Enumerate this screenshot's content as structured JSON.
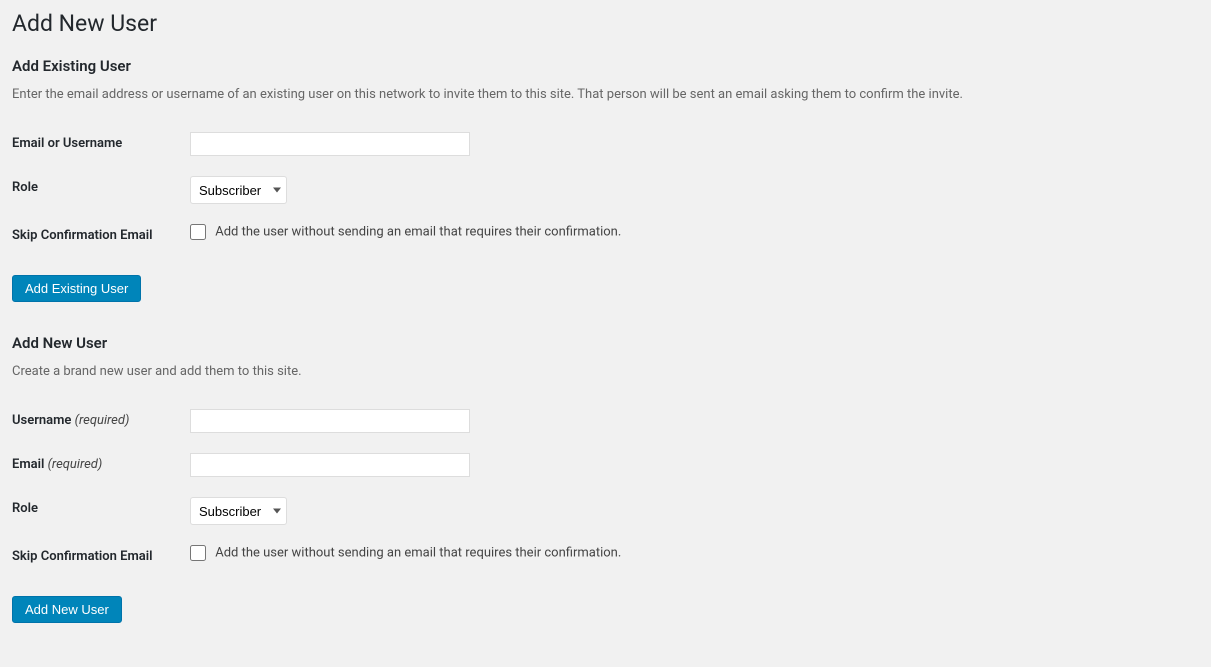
{
  "page": {
    "title": "Add New User"
  },
  "existing": {
    "heading": "Add Existing User",
    "description": "Enter the email address or username of an existing user on this network to invite them to this site. That person will be sent an email asking them to confirm the invite.",
    "emailOrUsernameLabel": "Email or Username",
    "roleLabel": "Role",
    "roleValue": "Subscriber",
    "skipLabel": "Skip Confirmation Email",
    "skipDescription": "Add the user without sending an email that requires their confirmation.",
    "submitLabel": "Add Existing User"
  },
  "newUser": {
    "heading": "Add New User",
    "description": "Create a brand new user and add them to this site.",
    "usernameLabel": "Username",
    "emailLabel": "Email",
    "requiredText": "(required)",
    "roleLabel": "Role",
    "roleValue": "Subscriber",
    "skipLabel": "Skip Confirmation Email",
    "skipDescription": "Add the user without sending an email that requires their confirmation.",
    "submitLabel": "Add New User"
  }
}
